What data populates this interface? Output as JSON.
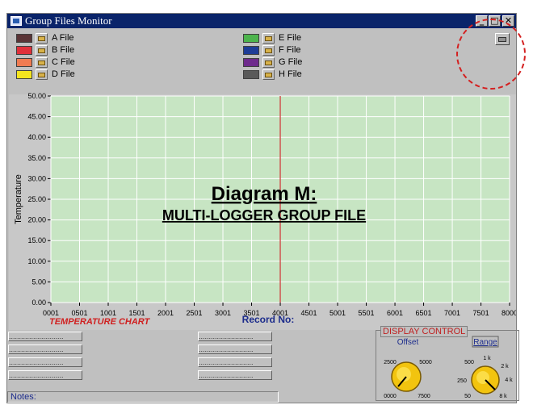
{
  "window": {
    "title": "Group Files Monitor"
  },
  "legend": [
    {
      "label": "A File",
      "color": "#5a3436"
    },
    {
      "label": "B File",
      "color": "#e0303a"
    },
    {
      "label": "C File",
      "color": "#ef7b52"
    },
    {
      "label": "D File",
      "color": "#f4e41e"
    },
    {
      "label": "E File",
      "color": "#4db44d"
    },
    {
      "label": "F File",
      "color": "#1e3c96"
    },
    {
      "label": "G File",
      "color": "#6e2a8c"
    },
    {
      "label": "H File",
      "color": "#5a5a5a"
    }
  ],
  "chart_data": {
    "type": "line",
    "title": "Diagram M:",
    "subtitle": "MULTI-LOGGER GROUP FILE",
    "xlabel": "Record No:",
    "ylabel": "Temperature",
    "chart_caption": "TEMPERATURE CHART",
    "y_ticks": [
      "0.00",
      "5.00",
      "10.00",
      "15.00",
      "20.00",
      "25.00",
      "30.00",
      "35.00",
      "40.00",
      "45.00",
      "50.00"
    ],
    "x_ticks": [
      "0001",
      "0501",
      "1001",
      "1501",
      "2001",
      "2501",
      "3001",
      "3501",
      "4001",
      "4501",
      "5001",
      "5501",
      "6001",
      "6501",
      "7001",
      "7501",
      "8000"
    ],
    "ylim": [
      0,
      50
    ],
    "xlim": [
      1,
      8000
    ],
    "cursor_x": 4001,
    "grid": true,
    "series": []
  },
  "buttons": {
    "left": [
      "...........................",
      "...........................",
      "...........................",
      "..........................."
    ],
    "middle": [
      "...........................",
      "...........................",
      "...........................",
      "..........................."
    ]
  },
  "notes_label": "Notes:",
  "display_control": {
    "title": "DISPLAY CONTROL",
    "offset_label": "Offset",
    "range_label": "Range",
    "offset_scale": [
      "2500",
      "5000",
      "0000",
      "7500"
    ],
    "range_scale": [
      "500",
      "1 k",
      "2 k",
      "4 k",
      "8 k",
      "50",
      "250"
    ]
  }
}
